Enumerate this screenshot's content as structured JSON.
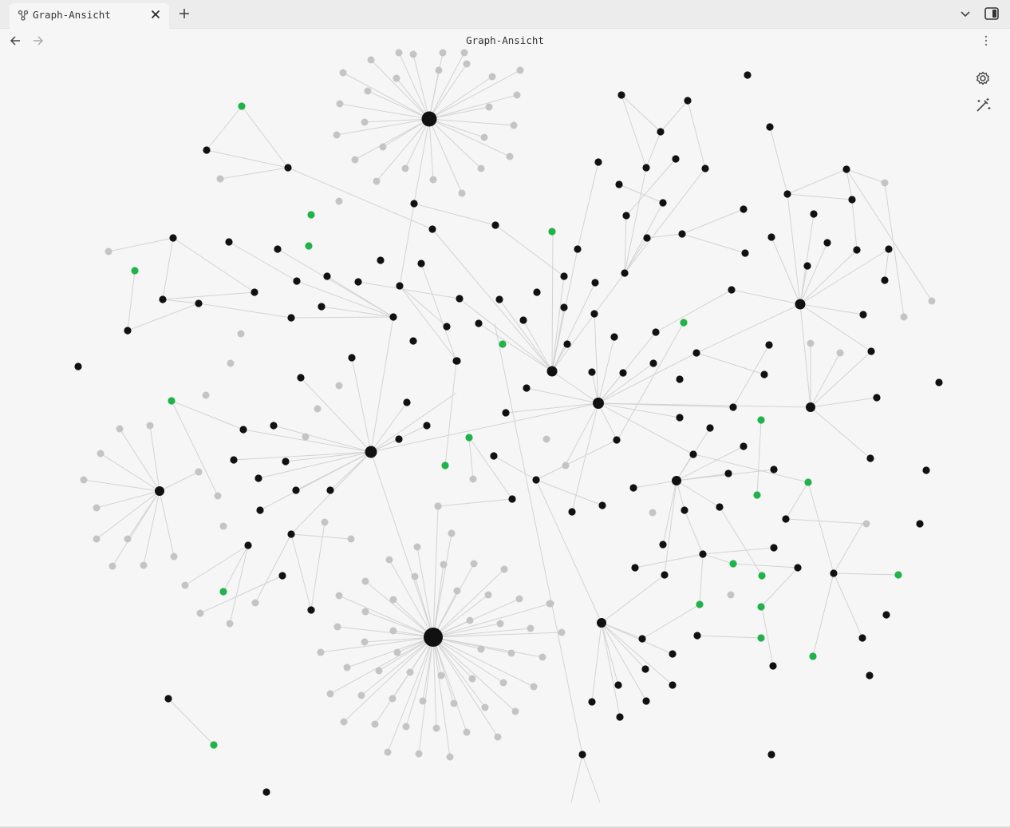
{
  "tab": {
    "title": "Graph-Ansicht",
    "icon": "graph-icon",
    "close_icon": "close-icon"
  },
  "tabbar": {
    "new_tab_icon": "plus-icon",
    "tab_list_icon": "chevron-down-icon",
    "sidebar_toggle_icon": "sidebar-toggle-icon"
  },
  "navbar": {
    "title": "Graph-Ansicht",
    "back_icon": "arrow-left-icon",
    "forward_icon": "arrow-right-icon",
    "more_icon": "more-options-icon"
  },
  "controls": {
    "settings_icon": "gear-icon",
    "animate_icon": "magic-wand-icon"
  },
  "colors": {
    "note": "#111111",
    "unresolved": "#c4c4c4",
    "tag": "#20b34a",
    "edge": "#d3d3d3",
    "background": "#f6f6f6"
  }
}
